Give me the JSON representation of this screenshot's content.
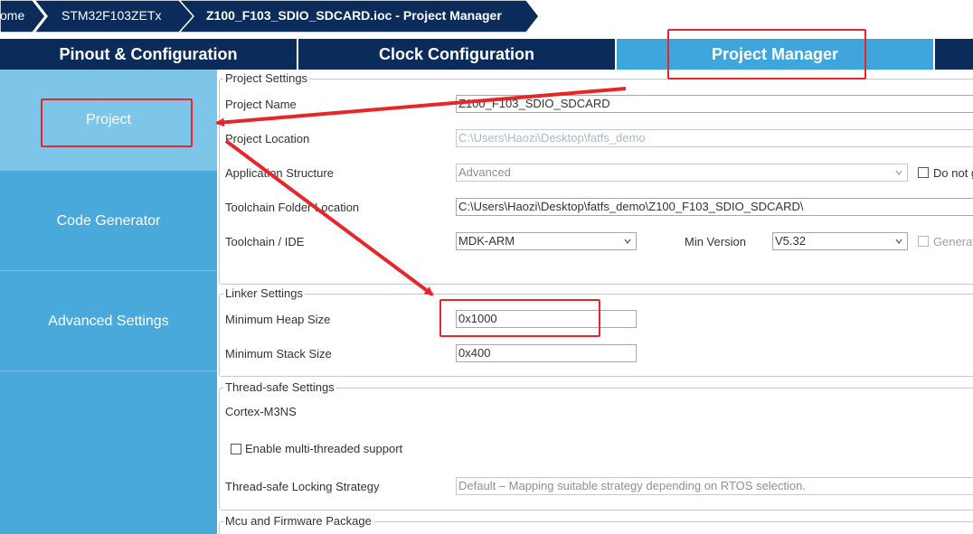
{
  "breadcrumb": [
    {
      "label": "ome"
    },
    {
      "label": "STM32F103ZETx"
    },
    {
      "label": "Z100_F103_SDIO_SDCARD.ioc - Project Manager"
    }
  ],
  "tabs": [
    {
      "label": "Pinout & Configuration"
    },
    {
      "label": "Clock Configuration"
    },
    {
      "label": "Project Manager"
    }
  ],
  "sidebar": [
    {
      "label": "Project"
    },
    {
      "label": "Code Generator"
    },
    {
      "label": "Advanced Settings"
    }
  ],
  "project_settings": {
    "title": "Project Settings",
    "project_name_label": "Project Name",
    "project_name_value": "Z100_F103_SDIO_SDCARD",
    "project_location_label": "Project Location",
    "project_location_value": "C:\\Users\\Haozi\\Desktop\\fatfs_demo",
    "app_structure_label": "Application Structure",
    "app_structure_value": "Advanced",
    "do_not_label": "Do not g",
    "toolchain_folder_label": "Toolchain Folder Location",
    "toolchain_folder_value": "C:\\Users\\Haozi\\Desktop\\fatfs_demo\\Z100_F103_SDIO_SDCARD\\",
    "toolchain_ide_label": "Toolchain / IDE",
    "toolchain_ide_value": "MDK-ARM",
    "min_version_label": "Min Version",
    "min_version_value": "V5.32",
    "generate_label": "Generat"
  },
  "linker_settings": {
    "title": "Linker Settings",
    "heap_label": "Minimum Heap Size",
    "heap_value": "0x1000",
    "stack_label": "Minimum Stack Size",
    "stack_value": "0x400"
  },
  "thread_safe": {
    "title": "Thread-safe Settings",
    "core": "Cortex-M3NS",
    "multithread_label": "Enable multi-threaded support",
    "locking_label": "Thread-safe Locking Strategy",
    "locking_value": "Default  –  Mapping suitable strategy depending on RTOS selection."
  },
  "mcu_fw": {
    "title": "Mcu and Firmware Package"
  },
  "colors": {
    "navy": "#0b2c5a",
    "accent": "#3ea6dc",
    "sidebar": "#4aa9db",
    "sidebar_active": "#7ec5ea",
    "annotation": "#e8262a"
  }
}
